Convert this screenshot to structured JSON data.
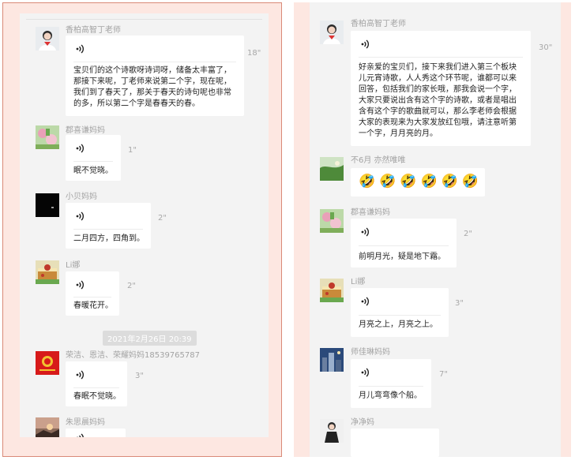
{
  "left": {
    "messages": [
      {
        "sender": "香柏高智丁老师",
        "duration": "18\"",
        "text": "宝贝们的这个诗歌呀诗词呀，储备太丰富了，\n那接下来呢，丁老师来说第二个字，现在呢，\n我们到了春天了，那关于春天的诗句呢也非常\n的多，所以第二个字是春春天的春。"
      },
      {
        "sender": "郡喜谦妈妈",
        "duration": "1\"",
        "text": "眠不觉晓。"
      },
      {
        "sender": "小贝妈妈",
        "duration": "2\"",
        "text": "二月四方，四角到。"
      },
      {
        "sender": "Li娜",
        "duration": "2\"",
        "text": "春暖花开。"
      },
      {
        "sender": "荣洁、恩洁、荣耀妈妈18539765787",
        "duration": "3\"",
        "text": "春眠不觉晓。"
      },
      {
        "sender": "朱思晨妈妈",
        "duration": "",
        "text": ""
      }
    ],
    "timestamp": "2021年2月26日 20:39"
  },
  "right": {
    "messages": [
      {
        "sender": "香柏高智丁老师",
        "duration": "30\"",
        "text": "好亲爱的宝贝们，接下来我们进入第三个板块\n儿元宵诗歌，人人秀这个环节呢，谁都可以来\n回答，包括我们的家长哦，那我会说一个字，\n大家只要说出含有这个字的诗歌，或者是唱出\n含有这个字的歌曲就可以，那么李老师会根据\n大家的表现来为大家发放红包哦，请注意听第\n一个字，月月亮的月。"
      },
      {
        "sender": "不6月 亦然唯唯",
        "duration": "",
        "text": "",
        "emojis": [
          "🤣",
          "🤣",
          "🤣",
          "🤣",
          "🤣",
          "🤣"
        ]
      },
      {
        "sender": "郡喜谦妈妈",
        "duration": "2\"",
        "text": "前明月光，疑是地下霜。"
      },
      {
        "sender": "Li娜",
        "duration": "3\"",
        "text": "月亮之上，月亮之上。"
      },
      {
        "sender": "师佳琳妈妈",
        "duration": "7\"",
        "text": "月儿弯弯像个船。"
      },
      {
        "sender": "净净妈",
        "duration": "",
        "text": ""
      }
    ]
  },
  "icons": {
    "voice": "voice-message-icon"
  },
  "colors": {
    "frame_bg": "#fde7e1",
    "chat_bg": "#f3f3f3",
    "frame_border": "#d98a78",
    "sender": "#a3a3a3"
  }
}
